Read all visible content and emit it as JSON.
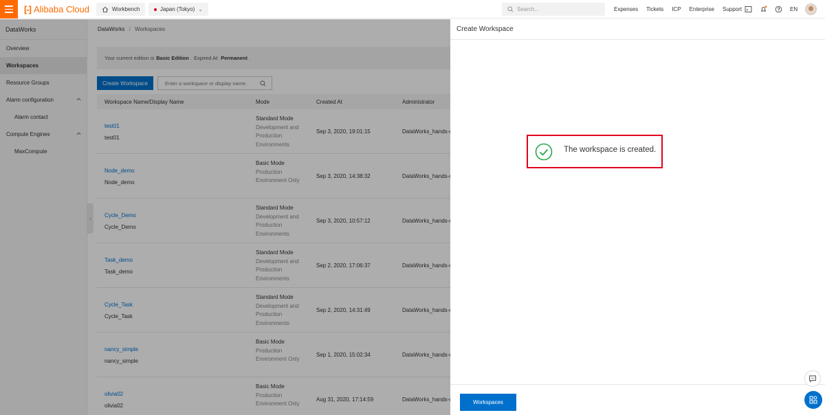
{
  "topbar": {
    "logo_mark": "[-]",
    "logo_text": "Alibaba Cloud",
    "workbench": "Workbench",
    "region": "Japan (Tokyo)",
    "search_placeholder": "Search...",
    "links": [
      "Expenses",
      "Tickets",
      "ICP",
      "Enterprise",
      "Support"
    ],
    "lang": "EN",
    "brand_color": "#ff6a00"
  },
  "sidebar": {
    "title": "DataWorks",
    "items": [
      {
        "label": "Overview"
      },
      {
        "label": "Workspaces"
      },
      {
        "label": "Resource Groups"
      },
      {
        "label": "Alarm configuration"
      },
      {
        "label": "Alarm contact"
      },
      {
        "label": "Compute Engines"
      },
      {
        "label": "MaxCompute"
      }
    ]
  },
  "main": {
    "breadcrumb": [
      "DataWorks",
      "/",
      "Workspaces"
    ],
    "edition_prefix": "Your current edition is",
    "edition": "Basic Edition",
    "expired_prefix": ". Expired At:",
    "expired": "Permanent",
    "expired_suffix": ".",
    "create_button": "Create Workspace",
    "search_placeholder": "Enter a workspace or display name.",
    "columns": [
      "Workspace Name/Display Name",
      "Mode",
      "Created At",
      "Administrator"
    ],
    "rows": [
      {
        "name": "test01",
        "display": "test01",
        "mode": "Standard Mode",
        "mode_desc": "Development and Production Environments",
        "created": "Sep 3, 2020, 19:01:15",
        "admin": "DataWorks_hands-o"
      },
      {
        "name": "Node_demo",
        "display": "Node_demo",
        "mode": "Basic Mode",
        "mode_desc": "Production Environment Only",
        "created": "Sep 3, 2020, 14:38:32",
        "admin": "DataWorks_hands-o"
      },
      {
        "name": "Cycle_Demo",
        "display": "Cycle_Demo",
        "mode": "Standard Mode",
        "mode_desc": "Development and Production Environments",
        "created": "Sep 3, 2020, 10:57:12",
        "admin": "DataWorks_hands-o"
      },
      {
        "name": "Task_demo",
        "display": "Task_demo",
        "mode": "Standard Mode",
        "mode_desc": "Development and Production Environments",
        "created": "Sep 2, 2020, 17:06:37",
        "admin": "DataWorks_hands-o"
      },
      {
        "name": "Cycle_Task",
        "display": "Cycle_Task",
        "mode": "Standard Mode",
        "mode_desc": "Development and Production Environments",
        "created": "Sep 2, 2020, 14:31:49",
        "admin": "DataWorks_hands-o"
      },
      {
        "name": "nancy_simple",
        "display": "nancy_simple",
        "mode": "Basic Mode",
        "mode_desc": "Production Environment Only",
        "created": "Sep 1, 2020, 15:02:34",
        "admin": "DataWorks_hands-o"
      },
      {
        "name": "olivia02",
        "display": "olivia02",
        "mode": "Basic Mode",
        "mode_desc": "Production Environment Only",
        "created": "Aug 31, 2020, 17:14:59",
        "admin": "DataWorks_hands-o"
      }
    ]
  },
  "drawer": {
    "title": "Create Workspace",
    "success_message": "The workspace is created.",
    "workspaces_button": "Workspaces",
    "success_color": "#2aa74a",
    "highlight_color": "#e0001b"
  }
}
